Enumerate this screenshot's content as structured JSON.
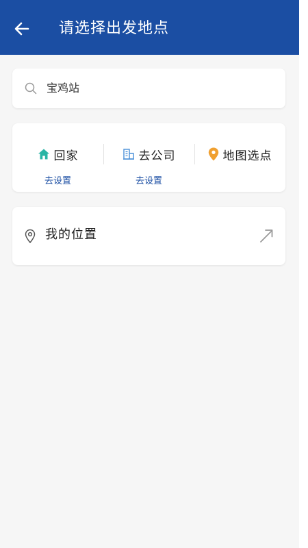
{
  "header": {
    "title": "请选择出发地点",
    "back_icon": "arrow-left-icon",
    "background": "#1b4ea3"
  },
  "search": {
    "value": "宝鸡站",
    "icon": "search-icon"
  },
  "shortcuts": {
    "home": {
      "label": "回家",
      "sub": "去设置",
      "icon": "home-icon",
      "icon_color": "#2ab5a5"
    },
    "office": {
      "label": "去公司",
      "sub": "去设置",
      "icon": "building-icon",
      "icon_color": "#4a90d9"
    },
    "map": {
      "label": "地图选点",
      "icon": "map-pin-icon",
      "icon_color": "#f0a030"
    }
  },
  "location": {
    "label": "我的位置",
    "icon": "location-pin-icon",
    "arrow_icon": "arrow-up-right-icon"
  },
  "colors": {
    "accent": "#1b4ea3",
    "page_background": "#f6f6f6"
  }
}
